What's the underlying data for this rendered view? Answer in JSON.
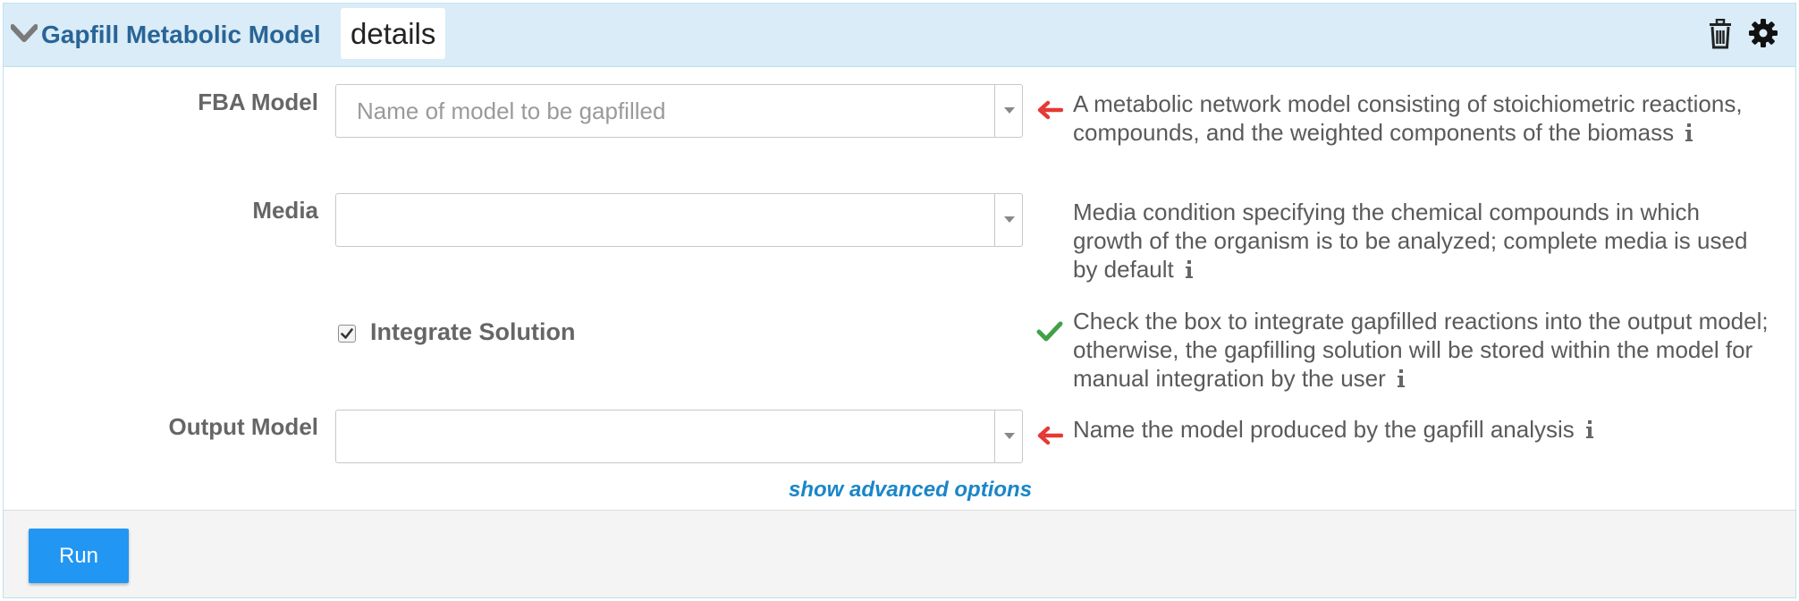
{
  "header": {
    "title": "Gapfill Metabolic Model",
    "details_tab": "details",
    "icons": [
      "chevron-down-icon",
      "trash-icon",
      "gear-icon"
    ]
  },
  "fields": {
    "fba_model": {
      "label": "FBA Model",
      "placeholder": "Name of model to be gapfilled",
      "value": "",
      "description": "A metabolic network model consisting of stoichiometric reactions, compounds, and the weighted components of the biomass",
      "status": "required-arrow"
    },
    "media": {
      "label": "Media",
      "value": "",
      "description": "Media condition specifying the chemical compounds in which growth of the organism is to be analyzed; complete media is used by default",
      "status": "none"
    },
    "integrate_solution": {
      "label": "Integrate Solution",
      "checked": true,
      "description": "Check the box to integrate gapfilled reactions into the output model; otherwise, the gapfilling solution will be stored within the model for manual integration by the user",
      "status": "valid-check"
    },
    "output_model": {
      "label": "Output Model",
      "value": "",
      "description": "Name the model produced by the gapfill analysis",
      "status": "required-arrow"
    }
  },
  "advanced_link": "show advanced options",
  "footer": {
    "run_label": "Run"
  },
  "colors": {
    "header_bg": "#d9ecf7",
    "title": "#2a6496",
    "required_arrow": "#e53935",
    "valid_check": "#43a047",
    "link": "#1a86c8",
    "run_button": "#2196f3"
  }
}
